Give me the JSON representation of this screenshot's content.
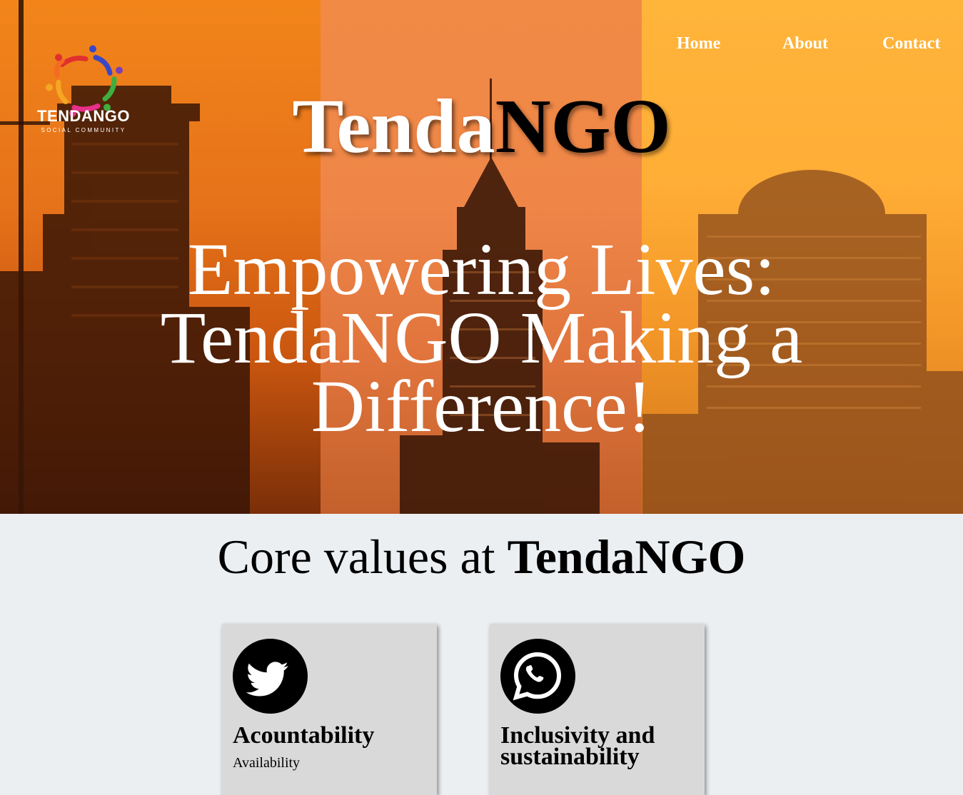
{
  "logo": {
    "wordmark": "TENDANGO",
    "tagline": "SOCIAL COMMUNITY"
  },
  "nav": {
    "home": "Home",
    "about": "About",
    "contact": "Contact"
  },
  "hero": {
    "title_part1": "Tenda",
    "title_part2": "NGO",
    "tagline": "Empowering Lives: TendaNGO Making a Difference!"
  },
  "values": {
    "heading_prefix": "Core values at",
    "heading_brand": "TendaNGO",
    "cards": [
      {
        "icon": "twitter-icon",
        "title": "Acountability",
        "subtitle": "Availability"
      },
      {
        "icon": "whatsapp-icon",
        "title": "Inclusivity and sustainability",
        "subtitle": ""
      }
    ]
  },
  "colors": {
    "hero_orange": "#f2851a",
    "hero_peach": "#ef8648",
    "hero_gold": "#ffb43a",
    "background": "#eceff2",
    "card": "#d9d9d9"
  }
}
